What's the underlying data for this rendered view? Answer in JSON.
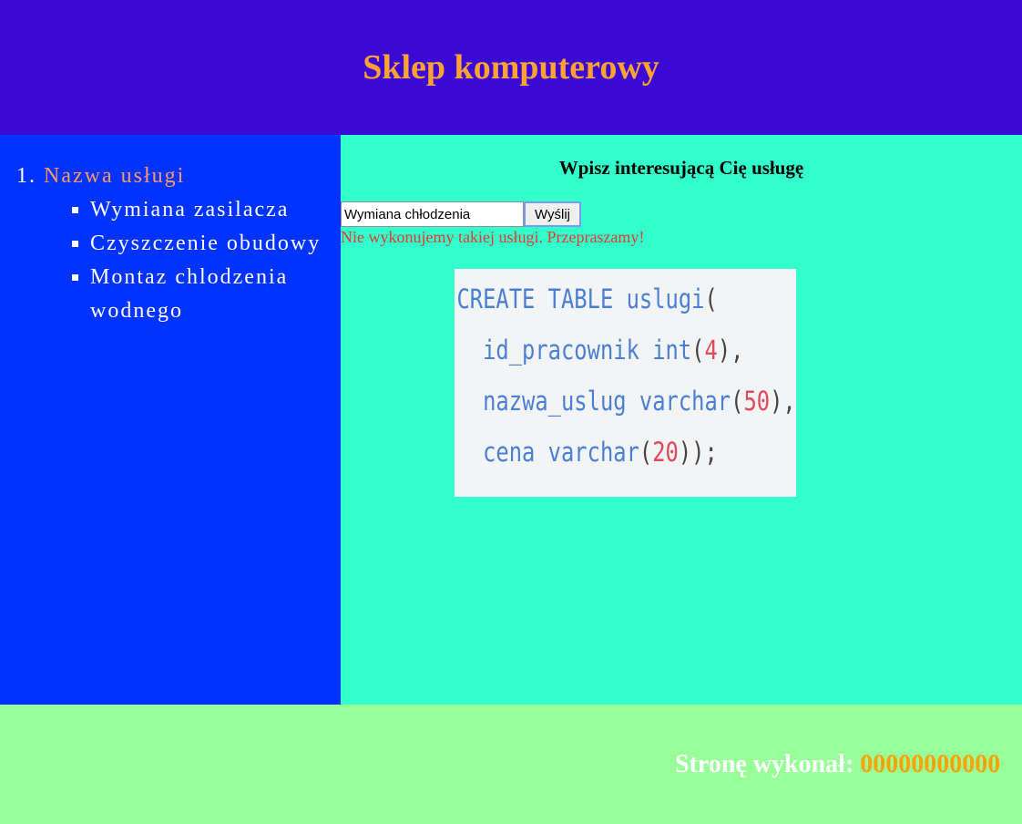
{
  "header": {
    "title": "Sklep komputerowy"
  },
  "menu": {
    "number": "1.",
    "category": "Nazwa usługi",
    "items": [
      {
        "label": "Wymiana zasilacza"
      },
      {
        "label": "Czyszczenie obudowy"
      },
      {
        "label": "Montaz chlodzenia wodnego"
      }
    ]
  },
  "main": {
    "prompt": "Wpisz interesującą Cię usługę",
    "input_value": "Wymiana chłodzenia",
    "submit_label": "Wyślij",
    "error_message": "Nie wykonujemy takiej usługi. Przepraszamy!"
  },
  "code_image": {
    "line1_kw": "CREATE TABLE uslugi",
    "line1_paren": "(",
    "line2_kw": "  id_pracownik int",
    "line2_open": "(",
    "line2_num": "4",
    "line2_close": "),",
    "line3_kw": "  nazwa_uslug varchar",
    "line3_open": "(",
    "line3_num": "50",
    "line3_close": "),",
    "line4_kw": "  cena varchar",
    "line4_open": "(",
    "line4_num": "20",
    "line4_close": "));"
  },
  "footer": {
    "author_label": "Stronę wykonał: ",
    "author_id": "00000000000"
  },
  "colors": {
    "header_bg": "#3a09d3",
    "title": "#ffa234",
    "left_bg": "#0033ff",
    "right_bg": "#33ffcc",
    "footer_bg": "#99ff99",
    "error": "#e53a2c"
  }
}
